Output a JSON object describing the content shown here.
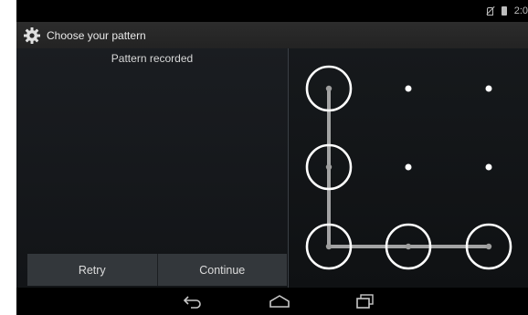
{
  "status_bar": {
    "time": "2:0",
    "icons": [
      "mute-icon",
      "battery-icon"
    ]
  },
  "title_bar": {
    "icon": "settings-gear-icon",
    "title": "Choose your pattern"
  },
  "header": {
    "message": "Pattern recorded"
  },
  "buttons": {
    "retry_label": "Retry",
    "continue_label": "Continue"
  },
  "pattern": {
    "grid_size": 3,
    "selected_sequence": [
      1,
      4,
      7,
      8,
      9
    ],
    "colors": {
      "line": "#bdbdbd",
      "ring": "#ffffff",
      "dot": "#ffffff"
    }
  },
  "nav_bar": {
    "icons": [
      "back-icon",
      "home-icon",
      "recent-apps-icon"
    ]
  }
}
